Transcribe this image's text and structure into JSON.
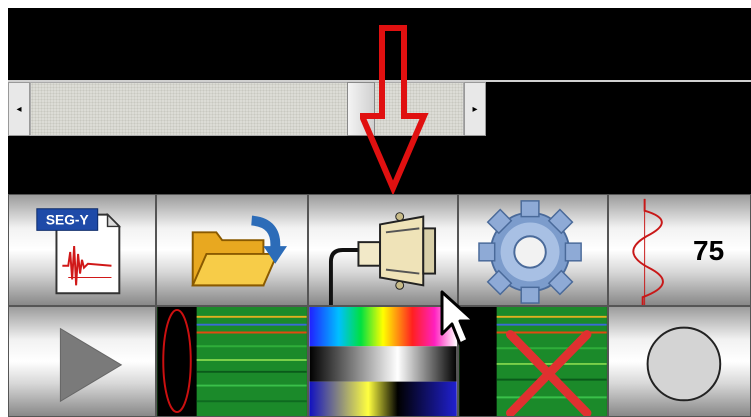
{
  "toolbar_row1": {
    "segy_label": "SEG-Y",
    "amplitude_value": "75"
  },
  "scrollbar": {
    "position_fraction": 0.78
  },
  "icons": {
    "segy_file": "segy-file-icon",
    "open_folder": "open-folder-icon",
    "connector": "serial-connector-icon",
    "settings": "gear-icon",
    "wavelet": "wavelet-icon",
    "play": "play-icon",
    "seismic_view": "seismic-section-icon",
    "color_scale": "color-palette-icon",
    "seismic_delete": "seismic-delete-icon",
    "record": "circle-record-icon",
    "annotation_arrow": "red-down-arrow-icon",
    "cursor": "mouse-cursor-icon"
  },
  "colors": {
    "highlight_red": "#e01010",
    "folder_yellow": "#f5c030",
    "gear_blue": "#6c8fc0"
  }
}
